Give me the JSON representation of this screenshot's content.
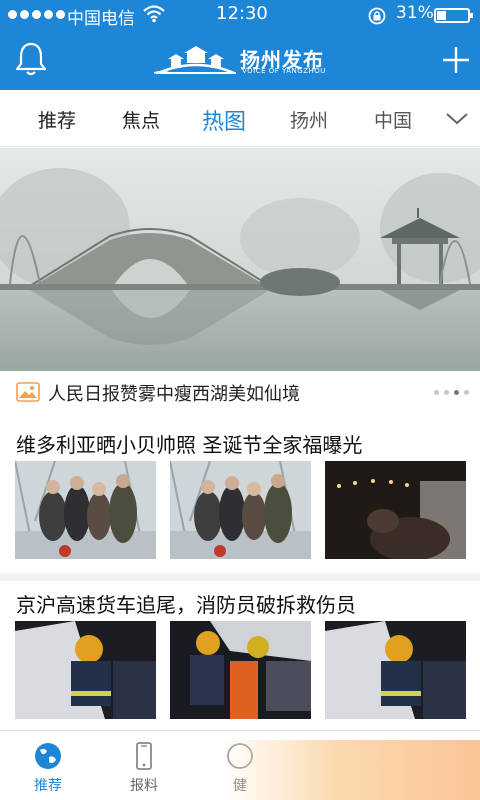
{
  "status_bar": {
    "carrier": "中国电信",
    "time": "12:30",
    "battery_pct": "31%",
    "battery_level": 0.31
  },
  "header": {
    "logo_title": "扬州发布",
    "logo_subtitle": "VOICE OF YANGZHOU"
  },
  "tabs": [
    {
      "label": "推荐"
    },
    {
      "label": "焦点"
    },
    {
      "label": "热图",
      "active": true
    },
    {
      "label": "扬州"
    },
    {
      "label": "中国"
    }
  ],
  "hero": {
    "caption": "人民日报赞雾中瘦西湖美如仙境",
    "slide_count": 4,
    "active_slide": 3
  },
  "articles": [
    {
      "title": "维多利亚晒小贝帅照 圣诞节全家福曝光"
    },
    {
      "title": "京沪高速货车追尾，消防员破拆救伤员"
    }
  ],
  "bottom_nav": [
    {
      "label": "推荐",
      "icon": "globe-icon",
      "active": true
    },
    {
      "label": "报料",
      "icon": "phone-icon"
    },
    {
      "label": "健",
      "icon": "health-icon"
    }
  ],
  "colors": {
    "brand_blue": "#1e86d7",
    "text": "#222222"
  }
}
